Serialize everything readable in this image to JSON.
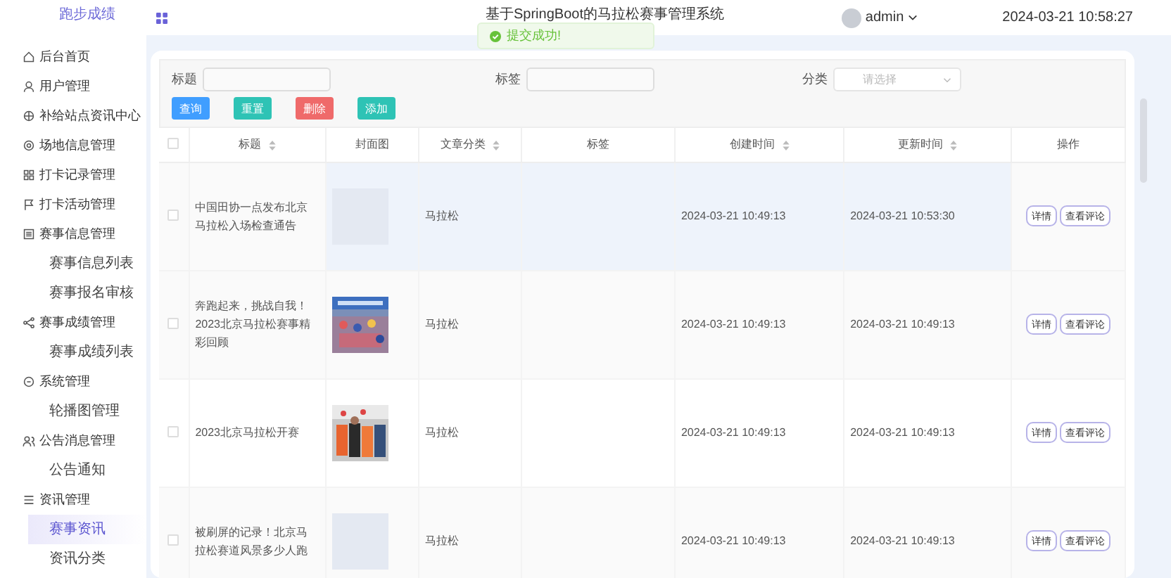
{
  "brand": "跑步成绩",
  "header": {
    "title": "基于SpringBoot的马拉松赛事管理系统",
    "user": "admin",
    "datetime": "2024-03-21 10:58:27"
  },
  "toast": {
    "kind": "success",
    "text": "提交成功!"
  },
  "sidebar": {
    "items": [
      {
        "label": "后台首页"
      },
      {
        "label": "用户管理"
      },
      {
        "label": "补给站点资讯中心"
      },
      {
        "label": "场地信息管理"
      },
      {
        "label": "打卡记录管理"
      },
      {
        "label": "打卡活动管理"
      },
      {
        "label": "赛事信息管理",
        "children": [
          {
            "label": "赛事信息列表",
            "selected": false
          },
          {
            "label": "赛事报名审核",
            "selected": false
          }
        ]
      },
      {
        "label": "赛事成绩管理",
        "children": [
          {
            "label": "赛事成绩列表",
            "selected": false
          }
        ]
      },
      {
        "label": "系统管理",
        "children": [
          {
            "label": "轮播图管理",
            "selected": false
          }
        ]
      },
      {
        "label": "公告消息管理",
        "children": [
          {
            "label": "公告通知",
            "selected": false
          }
        ]
      },
      {
        "label": "资讯管理",
        "children": [
          {
            "label": "赛事资讯",
            "selected": true
          },
          {
            "label": "资讯分类",
            "selected": false
          }
        ]
      }
    ]
  },
  "filters": [
    {
      "label": "标题",
      "kind": "input"
    },
    {
      "label": "标签",
      "kind": "input"
    },
    {
      "label": "分类",
      "kind": "select",
      "placeholder": "请选择"
    }
  ],
  "buttons": [
    {
      "label": "查询",
      "kind": "primary"
    },
    {
      "label": "重置",
      "kind": "success"
    },
    {
      "label": "删除",
      "kind": "danger"
    },
    {
      "label": "添加",
      "kind": "success"
    }
  ],
  "table": {
    "all_checked": false,
    "columns": [
      {
        "label": "标题",
        "sortable": true
      },
      {
        "label": "封面图",
        "sortable": false
      },
      {
        "label": "文章分类",
        "sortable": true
      },
      {
        "label": "标签",
        "sortable": false
      },
      {
        "label": "创建时间",
        "sortable": true
      },
      {
        "label": "更新时间",
        "sortable": true
      },
      {
        "label": "操作",
        "sortable": false
      }
    ],
    "rows": [
      {
        "checked": false,
        "highlighted": true,
        "title": "中国田协一点发布北京马拉松入场检查通告",
        "has_cover": false,
        "category": "马拉松",
        "created": "2024-03-21 10:49:13",
        "updated": "2024-03-21 10:53:30",
        "actions": [
          "详情",
          "查看评论"
        ]
      },
      {
        "checked": false,
        "highlighted": false,
        "title": "奔跑起来，挑战自我！2023北京马拉松赛事精彩回顾",
        "has_cover": true,
        "category": "马拉松",
        "created": "2024-03-21 10:49:13",
        "updated": "2024-03-21 10:49:13",
        "actions": [
          "详情",
          "查看评论"
        ]
      },
      {
        "checked": false,
        "highlighted": false,
        "title": "2023北京马拉松开赛",
        "has_cover": true,
        "category": "马拉松",
        "created": "2024-03-21 10:49:13",
        "updated": "2024-03-21 10:49:13",
        "actions": [
          "详情",
          "查看评论"
        ]
      },
      {
        "checked": false,
        "highlighted": false,
        "title": "被刷屏的记录！北京马拉松赛道风景多少人跑",
        "has_cover": false,
        "category": "马拉松",
        "created": "2024-03-21 10:49:13",
        "updated": "2024-03-21 10:49:13",
        "actions": [
          "详情",
          "查看评论"
        ]
      }
    ]
  }
}
